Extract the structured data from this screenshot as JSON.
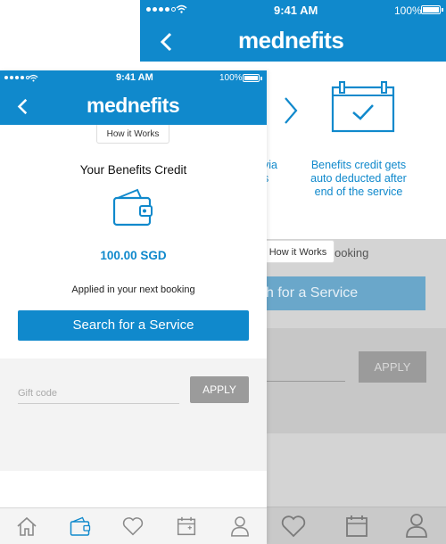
{
  "status_bar": {
    "time": "9:41 AM",
    "battery": "100%"
  },
  "brand": {
    "logo_text": "mednefits"
  },
  "back_screen": {
    "step_left_text": [
      "via",
      "s"
    ],
    "step_right_text": "Benefits credit gets auto deducted after end of the service",
    "booking_fragment": "ooking",
    "search_fragment": "h for a Service",
    "apply_label": "APPLY"
  },
  "front_screen": {
    "how_it_works_label": "How it Works",
    "credit_title": "Your Benefits Credit",
    "credit_amount": "100.00 SGD",
    "applied_text": "Applied in your next booking",
    "search_button_label": "Search for a Service",
    "gift_placeholder": "Gift code",
    "apply_label": "APPLY"
  },
  "overlay_how_it_works_label": "How it Works",
  "tab_bar": [
    "home-icon",
    "wallet-icon",
    "heart-icon",
    "calendar-icon",
    "profile-icon"
  ],
  "colors": {
    "brand_blue": "#1089cc",
    "apply_grey": "#9b9b9b",
    "tab_active": "#1089cc",
    "tab_inactive": "#8a8a8a"
  }
}
